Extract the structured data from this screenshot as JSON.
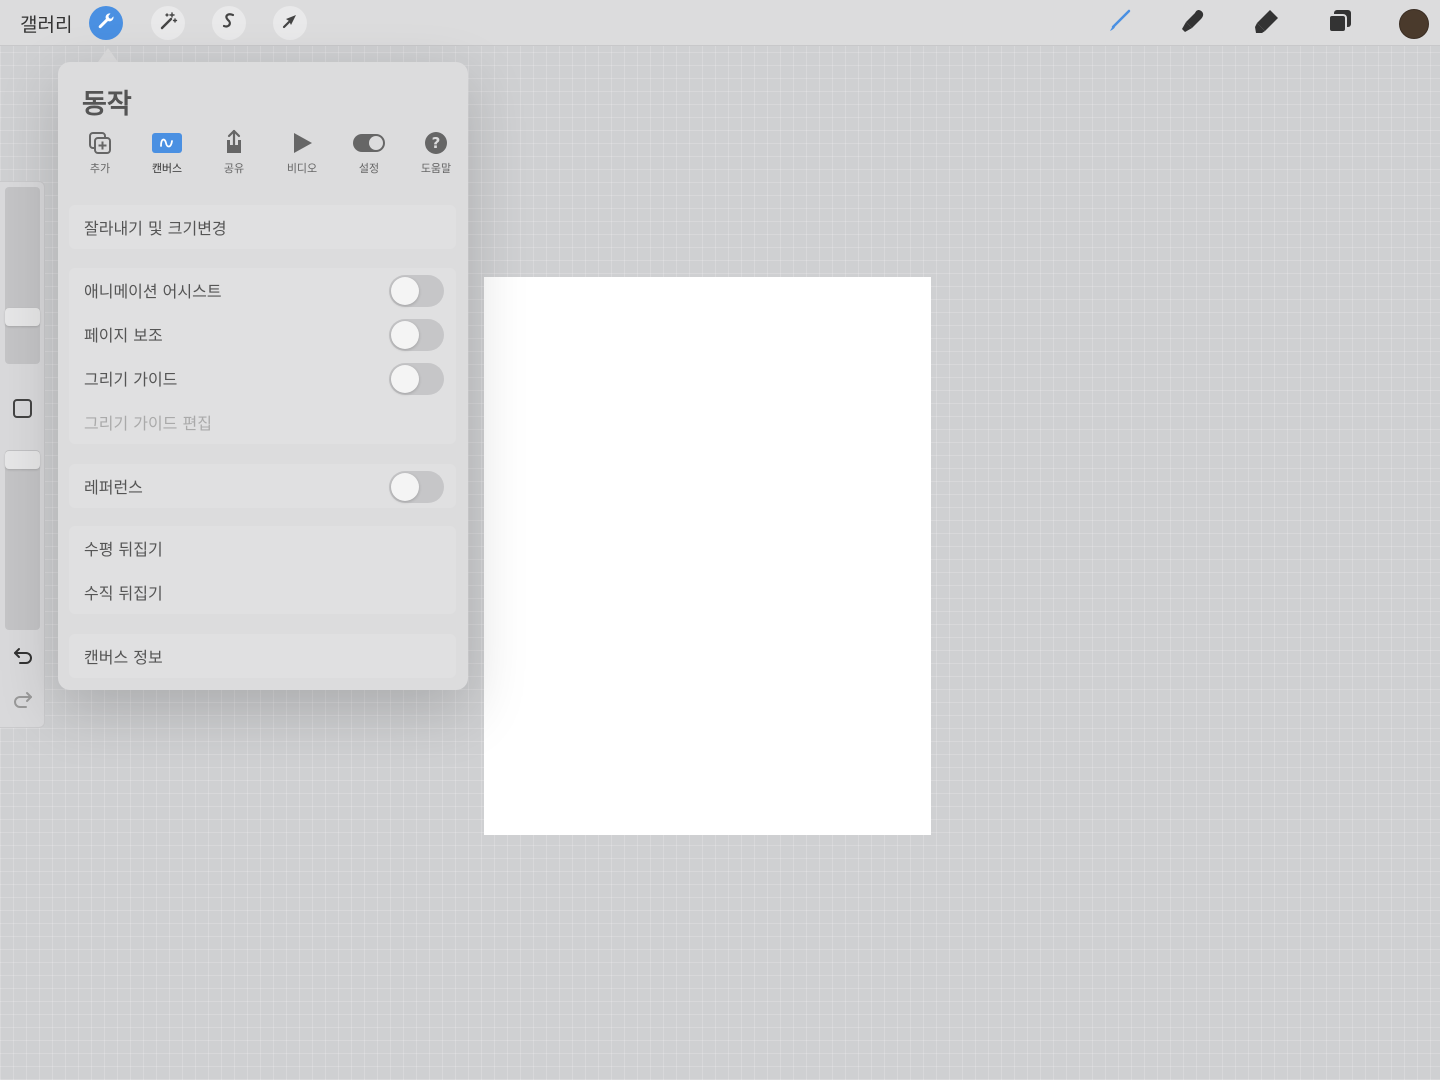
{
  "topbar": {
    "gallery_label": "갤러리",
    "left_tools": [
      {
        "icon": "wrench-icon",
        "active": true
      },
      {
        "icon": "magic-wand-icon",
        "active": false
      },
      {
        "icon": "selection-s-icon",
        "active": false
      },
      {
        "icon": "transform-arrow-icon",
        "active": false
      }
    ],
    "right_tools": [
      "brush-icon",
      "smudge-icon",
      "eraser-icon",
      "layers-icon"
    ],
    "current_color": "#4a3a2c",
    "accent": "#4a90e2"
  },
  "actions": {
    "title": "동작",
    "tabs": [
      {
        "label": "추가",
        "icon": "add-icon"
      },
      {
        "label": "캔버스",
        "icon": "canvas-icon",
        "active": true
      },
      {
        "label": "공유",
        "icon": "share-icon"
      },
      {
        "label": "비디오",
        "icon": "video-play-icon"
      },
      {
        "label": "설정",
        "icon": "settings-toggle-icon"
      },
      {
        "label": "도움말",
        "icon": "help-icon"
      }
    ],
    "crop_resize": "잘라내기 및 크기변경",
    "animation_assist": {
      "label": "애니메이션 어시스트",
      "on": false
    },
    "page_assist": {
      "label": "페이지 보조",
      "on": false
    },
    "drawing_guide": {
      "label": "그리기 가이드",
      "on": false
    },
    "edit_drawing_guide": "그리기 가이드 편집",
    "reference": {
      "label": "레퍼런스",
      "on": false
    },
    "flip_horizontal": "수평 뒤집기",
    "flip_vertical": "수직 뒤집기",
    "canvas_info": "캔버스 정보"
  },
  "sidebar": {
    "brush_size_level": 0.72,
    "opacity_level": 1.0
  }
}
